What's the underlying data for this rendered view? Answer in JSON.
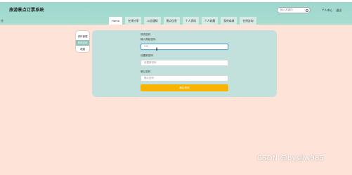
{
  "header": {
    "site_title": "旅游景点订票系统",
    "search_placeholder": "输入关键词",
    "user_menu": [
      "个人中心",
      "退出"
    ]
  },
  "nav": {
    "items": [
      "Home",
      "在线分享",
      "公告通知",
      "景点信息",
      "个人资料",
      "个人收藏",
      "我的商城",
      "在线咨询"
    ],
    "active_index": 0
  },
  "content_label": "修",
  "sidebar": {
    "items": [
      "资料管理",
      "修改密码",
      "收藏"
    ],
    "active_index": 1
  },
  "form": {
    "section_title": "修改密码",
    "old_password_label": "输入原始密码",
    "old_password_value": "•••",
    "new_password_label": "设置新密码",
    "new_password_placeholder": "设置新密码",
    "confirm_label": "确认密码",
    "confirm_placeholder": "确认密码",
    "submit_label": "确认修改"
  },
  "watermark": "CSDN @bysjlw985",
  "colors": {
    "header_bg": "#a8dccf",
    "content_bg": "#fde3d8",
    "panel_bg": "#c2e1dc",
    "button_bg": "#f8b400",
    "active_side": "#8ec3bb"
  }
}
